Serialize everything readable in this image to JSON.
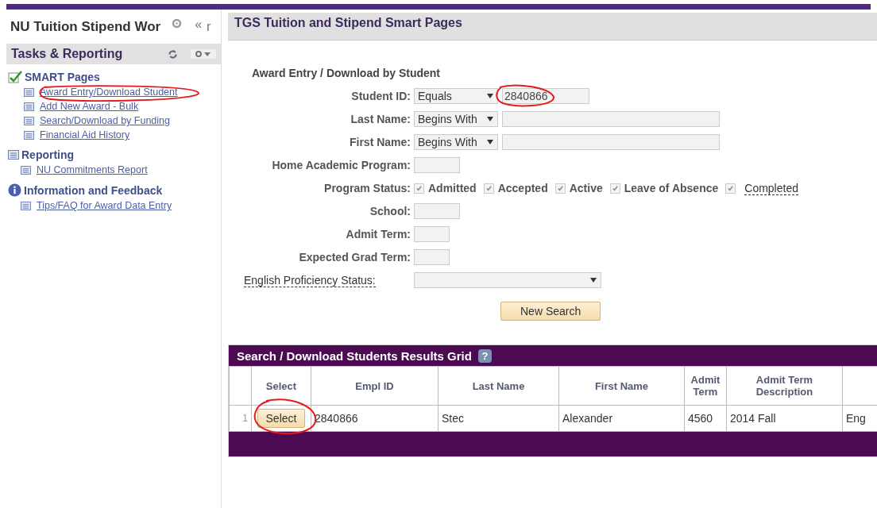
{
  "sidebar": {
    "title": "NU Tuition Stipend Wor",
    "collapse": "«",
    "cut_text": "r",
    "panel_title": "Tasks & Reporting",
    "sections": [
      {
        "kind": "check",
        "label": "SMART Pages",
        "links": [
          "Award Entry/Download Student",
          "Add New Award - Bulk",
          "Search/Download by Funding",
          "Financial Aid History"
        ]
      },
      {
        "kind": "list",
        "label": "Reporting",
        "links": [
          "NU Commitments Report"
        ]
      },
      {
        "kind": "info",
        "label": "Information and Feedback",
        "links": [
          "Tips/FAQ for Award Data Entry"
        ]
      }
    ]
  },
  "header": {
    "title": "TGS Tuition and Stipend Smart Pages"
  },
  "form": {
    "title": "Award Entry / Download by Student",
    "fields": [
      {
        "kind": "operator",
        "label": "Student ID:",
        "operator": "Equals",
        "value": "2840866"
      },
      {
        "kind": "operator",
        "label": "Last Name:",
        "operator": "Begins With"
      },
      {
        "kind": "operator",
        "label": "First Name:",
        "operator": "Begins With"
      },
      {
        "kind": "text",
        "label": "Home Academic Program:"
      },
      {
        "kind": "checks",
        "label": "Program Status:",
        "options": [
          {
            "label": "Admitted",
            "checked": true
          },
          {
            "label": "Accepted",
            "checked": true
          },
          {
            "label": "Active",
            "checked": true
          },
          {
            "label": "Leave of Absence",
            "checked": true
          },
          {
            "label": "Completed",
            "checked": true,
            "tip": true
          }
        ]
      },
      {
        "kind": "text",
        "label": "School:"
      },
      {
        "kind": "text",
        "label": "Admit Term:"
      },
      {
        "kind": "text",
        "label": "Expected Grad Term:"
      },
      {
        "kind": "dropdown",
        "label": "English Proficiency Status:",
        "tip": true
      }
    ],
    "button": "New Search"
  },
  "grid": {
    "title": "Search / Download Students Results Grid",
    "help": "?",
    "columns": [
      "",
      "Select",
      "Empl ID",
      "Last Name",
      "First Name",
      "Admit Term",
      "Admit Term Description",
      ""
    ],
    "rows": [
      {
        "cells": [
          "1",
          "Select",
          "2840866",
          "Stec",
          "Alexander",
          "4560",
          "2014 Fall",
          "Eng"
        ]
      }
    ]
  }
}
